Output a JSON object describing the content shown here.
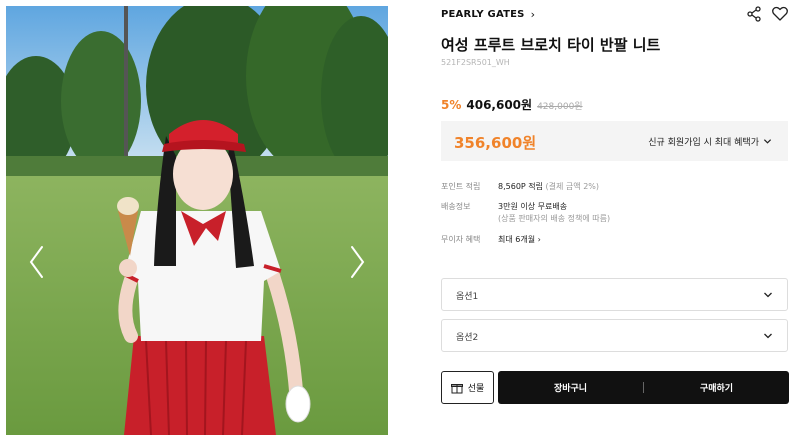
{
  "gallery": {
    "image_alt": "Woman in red visor and white polo holding an ice cream cone on a golf course",
    "prev_icon": "chevron-left-icon",
    "next_icon": "chevron-right-icon"
  },
  "product": {
    "brand": "PEARLY GATES",
    "brand_chevron": "›",
    "title": "여성 프루트 브로치 타이 반팔 니트",
    "code": "521F2SR501_WH",
    "discount": "5%",
    "sale_price": "406,600원",
    "original_price": "428,000원"
  },
  "benefit": {
    "price": "356,600원",
    "link_label": "신규 회원가입 시 최대 혜택가"
  },
  "info": {
    "points_label": "포인트 적립",
    "points_value": "8,560P 적립",
    "points_note": "(결제 금액 2%)",
    "shipping_label": "배송정보",
    "shipping_value": "3만원 이상 무료배송",
    "shipping_note": "(상품 판매자의 배송 정책에 따름)",
    "installment_label": "무이자 혜택",
    "installment_value": "최대 6개월",
    "installment_chevron": "›"
  },
  "options": [
    {
      "label": "옵션1"
    },
    {
      "label": "옵션2"
    }
  ],
  "actions": {
    "gift_label": "선물",
    "cart_label": "장바구니",
    "buy_label": "구매하기"
  },
  "colors": {
    "accent": "#f0832a",
    "primary": "#111111",
    "box_bg": "#f4f4f4"
  }
}
